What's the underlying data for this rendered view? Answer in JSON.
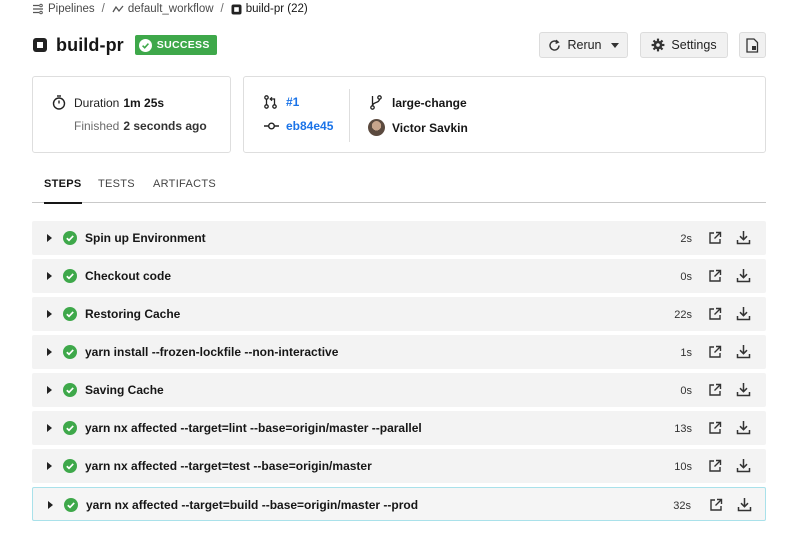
{
  "breadcrumb": {
    "pipelines": "Pipelines",
    "workflow": "default_workflow",
    "job": "build-pr (22)"
  },
  "header": {
    "title": "build-pr",
    "status": "SUCCESS",
    "rerun_label": "Rerun",
    "settings_label": "Settings"
  },
  "summary": {
    "duration_label": "Duration",
    "duration_value": "1m 25s",
    "finished_label": "Finished",
    "finished_value": "2 seconds ago",
    "pr": "#1",
    "commit": "eb84e45",
    "branch": "large-change",
    "author": "Victor Savkin"
  },
  "tabs": [
    "STEPS",
    "TESTS",
    "ARTIFACTS"
  ],
  "steps": [
    {
      "name": "Spin up Environment",
      "duration": "2s"
    },
    {
      "name": "Checkout code",
      "duration": "0s"
    },
    {
      "name": "Restoring Cache",
      "duration": "22s"
    },
    {
      "name": "yarn install --frozen-lockfile --non-interactive",
      "duration": "1s"
    },
    {
      "name": "Saving Cache",
      "duration": "0s"
    },
    {
      "name": "yarn nx affected --target=lint --base=origin/master --parallel",
      "duration": "13s"
    },
    {
      "name": "yarn nx affected --target=test --base=origin/master",
      "duration": "10s"
    },
    {
      "name": "yarn nx affected --target=build --base=origin/master --prod",
      "duration": "32s"
    }
  ],
  "colors": {
    "success": "#3ea84a",
    "link": "#1a73e8",
    "selected_border": "#a9e1ea"
  }
}
